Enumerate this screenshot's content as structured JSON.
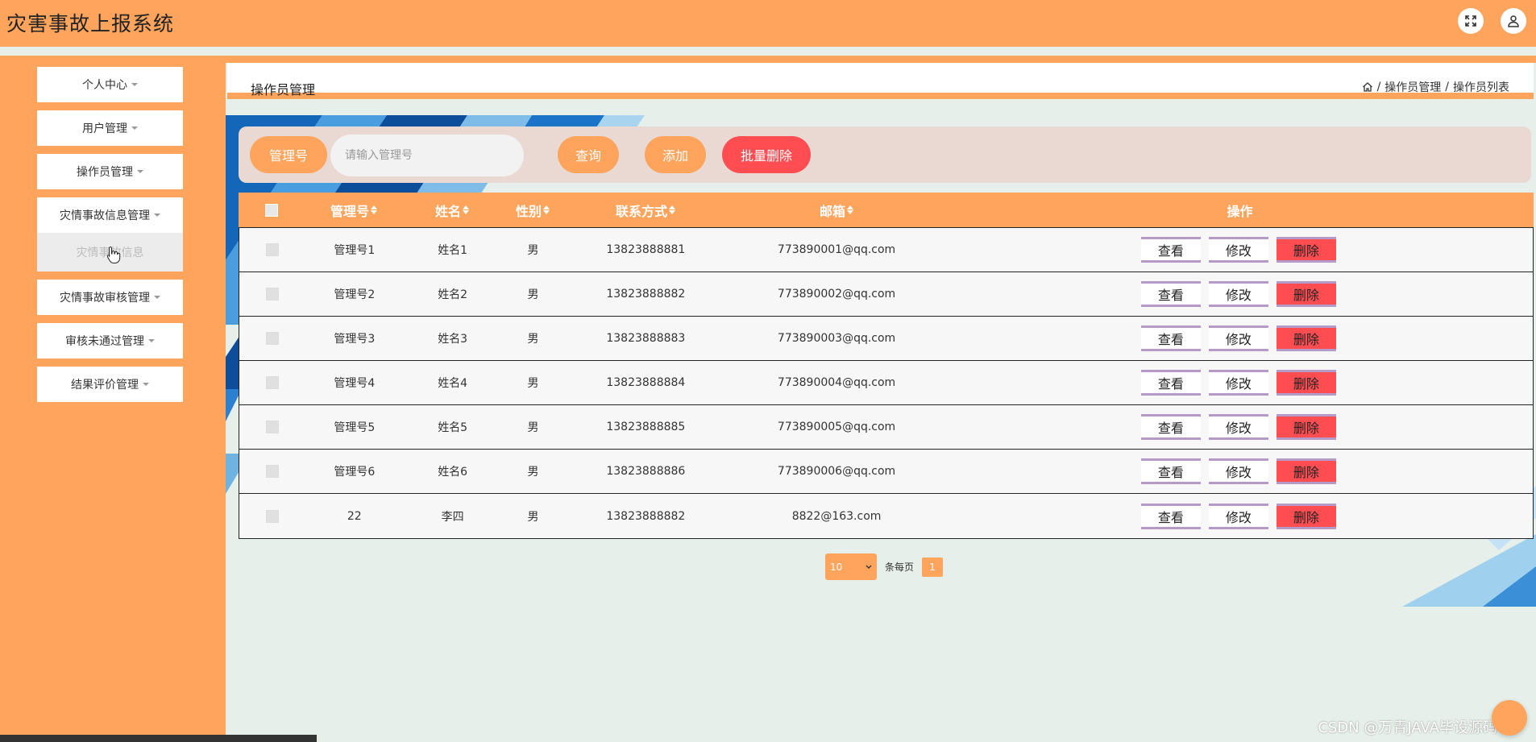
{
  "header": {
    "title": "灾害事故上报系统",
    "icons": [
      "fullscreen-icon",
      "user-icon"
    ]
  },
  "sidebar": {
    "items": [
      {
        "label": "个人中心"
      },
      {
        "label": "用户管理"
      },
      {
        "label": "操作员管理"
      },
      {
        "label": "灾情事故信息管理",
        "sub": "灾情事故信息"
      },
      {
        "label": "灾情事故审核管理"
      },
      {
        "label": "审核未通过管理"
      },
      {
        "label": "结果评价管理"
      }
    ]
  },
  "breadcrumb": {
    "page_title": "操作员管理",
    "path": [
      "操作员管理",
      "操作员列表"
    ],
    "separator": "/"
  },
  "search": {
    "label": "管理号",
    "placeholder": "请输入管理号",
    "query_button": "查询",
    "add_button": "添加",
    "batch_delete_button": "批量删除"
  },
  "table": {
    "columns": [
      "管理号",
      "姓名",
      "性别",
      "联系方式",
      "邮箱",
      "操作"
    ],
    "rows": [
      {
        "no": "管理号1",
        "name": "姓名1",
        "sex": "男",
        "phone": "13823888881",
        "email": "773890001@qq.com"
      },
      {
        "no": "管理号2",
        "name": "姓名2",
        "sex": "男",
        "phone": "13823888882",
        "email": "773890002@qq.com"
      },
      {
        "no": "管理号3",
        "name": "姓名3",
        "sex": "男",
        "phone": "13823888883",
        "email": "773890003@qq.com"
      },
      {
        "no": "管理号4",
        "name": "姓名4",
        "sex": "男",
        "phone": "13823888884",
        "email": "773890004@qq.com"
      },
      {
        "no": "管理号5",
        "name": "姓名5",
        "sex": "男",
        "phone": "13823888885",
        "email": "773890005@qq.com"
      },
      {
        "no": "管理号6",
        "name": "姓名6",
        "sex": "男",
        "phone": "13823888886",
        "email": "773890006@qq.com"
      },
      {
        "no": "22",
        "name": "李四",
        "sex": "男",
        "phone": "13823888882",
        "email": "8822@163.com"
      }
    ],
    "actions": {
      "view": "查看",
      "edit": "修改",
      "delete": "删除"
    }
  },
  "pagination": {
    "page_size": "10",
    "per_page_label": "条每页",
    "current_page": "1"
  },
  "watermark": "CSDN @万青JAVA毕设源码",
  "colors": {
    "primary": "#ffa45c",
    "danger": "#ff4d52",
    "content_bg": "#e6efe9"
  }
}
